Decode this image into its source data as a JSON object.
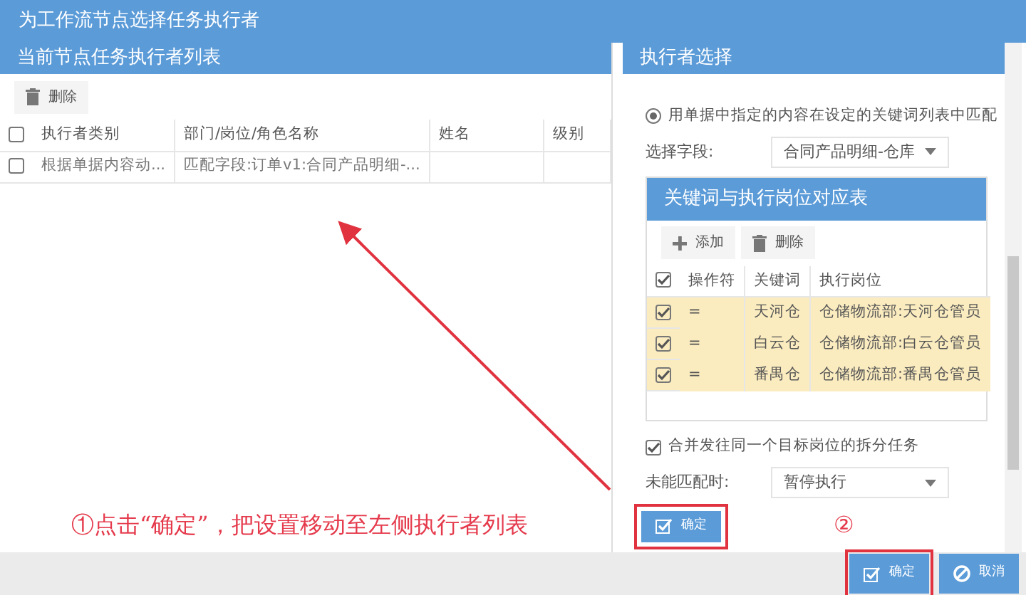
{
  "window": {
    "title": "为工作流节点选择任务执行者"
  },
  "left_panel": {
    "title": "当前节点任务执行者列表",
    "toolbar": [
      {
        "kind": "delete",
        "label": "删除"
      }
    ],
    "table": {
      "columns": [
        "执行者类别",
        "部门/岗位/角色名称",
        "姓名",
        "级别"
      ],
      "header_checked": false,
      "rows": [
        {
          "checked": false,
          "cells": [
            "根据单据内容动...",
            "匹配字段:订单v1:合同产品明细-..."
          ]
        }
      ]
    }
  },
  "right_panel": {
    "title": "执行者选择",
    "radio_options": [
      {
        "label": "用单据中指定的内容在设定的关键词列表中匹配",
        "selected": true
      }
    ],
    "field_select": {
      "label": "选择字段:",
      "value": "合同产品明细-仓库"
    },
    "keyword_table": {
      "title": "关键词与执行岗位对应表",
      "toolbar": [
        {
          "kind": "add",
          "label": "添加"
        },
        {
          "kind": "delete",
          "label": "删除"
        }
      ],
      "columns": [
        "操作符",
        "关键词",
        "执行岗位"
      ],
      "header_checked": true,
      "rows": [
        {
          "checked": true,
          "cells": [
            "=",
            "天河仓",
            "仓储物流部:天河仓管员"
          ]
        },
        {
          "checked": true,
          "cells": [
            "=",
            "白云仓",
            "仓储物流部:白云仓管员"
          ]
        },
        {
          "checked": true,
          "cells": [
            "=",
            "番禺仓",
            "仓储物流部:番禺仓管员"
          ]
        }
      ]
    },
    "merge_option": {
      "label": "合并发往同一个目标岗位的拆分任务",
      "checked": true
    },
    "unmatched_select": {
      "label": "未能匹配时:",
      "value": "暂停执行"
    },
    "confirm_button": {
      "label": "确定"
    }
  },
  "footer_buttons": [
    {
      "kind": "confirm",
      "label": "确定"
    },
    {
      "kind": "cancel",
      "label": "取消"
    }
  ],
  "annotations": {
    "note": "①点击“确定”，把设置移动至左侧执行者列表",
    "step_marker": "②"
  }
}
